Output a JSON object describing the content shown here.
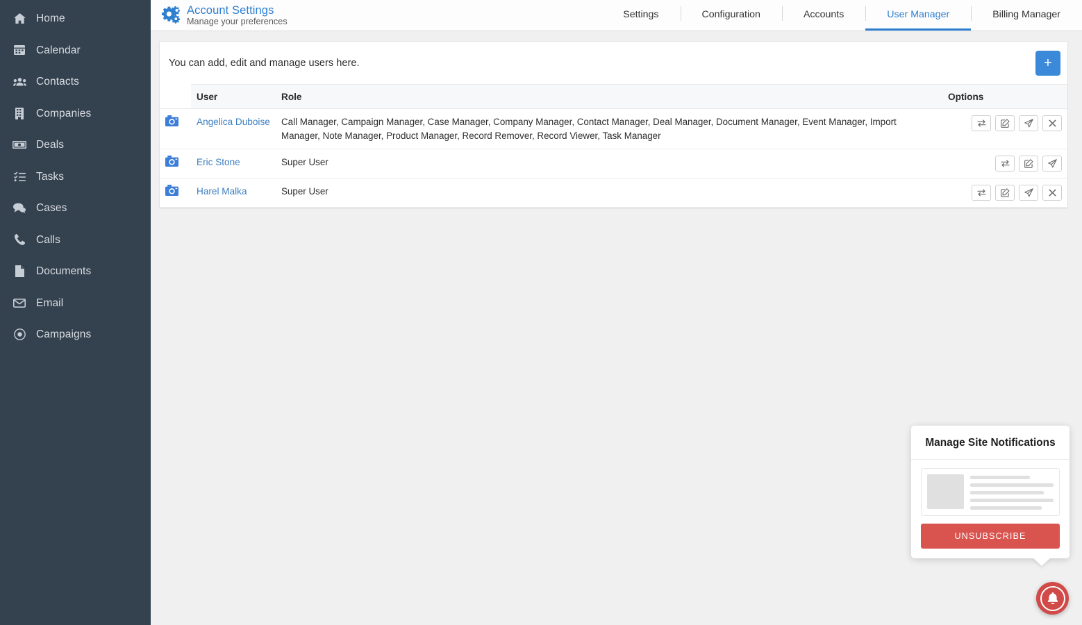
{
  "sidebar": {
    "items": [
      {
        "label": "Home",
        "icon": "home-icon"
      },
      {
        "label": "Calendar",
        "icon": "calendar-icon"
      },
      {
        "label": "Contacts",
        "icon": "contacts-icon"
      },
      {
        "label": "Companies",
        "icon": "building-icon"
      },
      {
        "label": "Deals",
        "icon": "money-icon"
      },
      {
        "label": "Tasks",
        "icon": "tasks-icon"
      },
      {
        "label": "Cases",
        "icon": "comments-icon"
      },
      {
        "label": "Calls",
        "icon": "phone-icon"
      },
      {
        "label": "Documents",
        "icon": "document-icon"
      },
      {
        "label": "Email",
        "icon": "envelope-icon"
      },
      {
        "label": "Campaigns",
        "icon": "target-icon"
      }
    ]
  },
  "header": {
    "icon": "cogs-icon",
    "title": "Account Settings",
    "subtitle": "Manage your preferences",
    "tabs": [
      {
        "label": "Settings",
        "active": false
      },
      {
        "label": "Configuration",
        "active": false
      },
      {
        "label": "Accounts",
        "active": false
      },
      {
        "label": "User Manager",
        "active": true
      },
      {
        "label": "Billing Manager",
        "active": false
      }
    ]
  },
  "main": {
    "intro_text": "You can add, edit and manage users here.",
    "add_button_label": "+",
    "table": {
      "columns": [
        "",
        "User",
        "Role",
        "Options"
      ],
      "rows": [
        {
          "avatar_icon": "camera-icon",
          "user": "Angelica Duboise",
          "role": "Call Manager, Campaign Manager, Case Manager, Company Manager, Contact Manager, Deal Manager, Document Manager, Event Manager, Import Manager, Note Manager, Product Manager, Record Remover, Record Viewer, Task Manager",
          "options": [
            "exchange-icon",
            "edit-icon",
            "send-icon",
            "delete-icon"
          ]
        },
        {
          "avatar_icon": "camera-icon",
          "user": "Eric Stone",
          "role": "Super User",
          "options": [
            "exchange-icon",
            "edit-icon",
            "send-icon"
          ]
        },
        {
          "avatar_icon": "camera-icon",
          "user": "Harel Malka",
          "role": "Super User",
          "options": [
            "exchange-icon",
            "edit-icon",
            "send-icon",
            "delete-icon"
          ]
        }
      ]
    }
  },
  "notifications": {
    "title": "Manage Site Notifications",
    "unsubscribe_label": "UNSUBSCRIBE",
    "fab_icon": "bell-icon"
  },
  "colors": {
    "sidebar_bg": "#34414f",
    "accent_blue": "#2f7fd1",
    "add_button_blue": "#3b8ad9",
    "link_blue": "#3d7fc1",
    "danger_red": "#d9534f",
    "fab_red": "#d04a48",
    "page_bg": "#f0f0f0"
  }
}
